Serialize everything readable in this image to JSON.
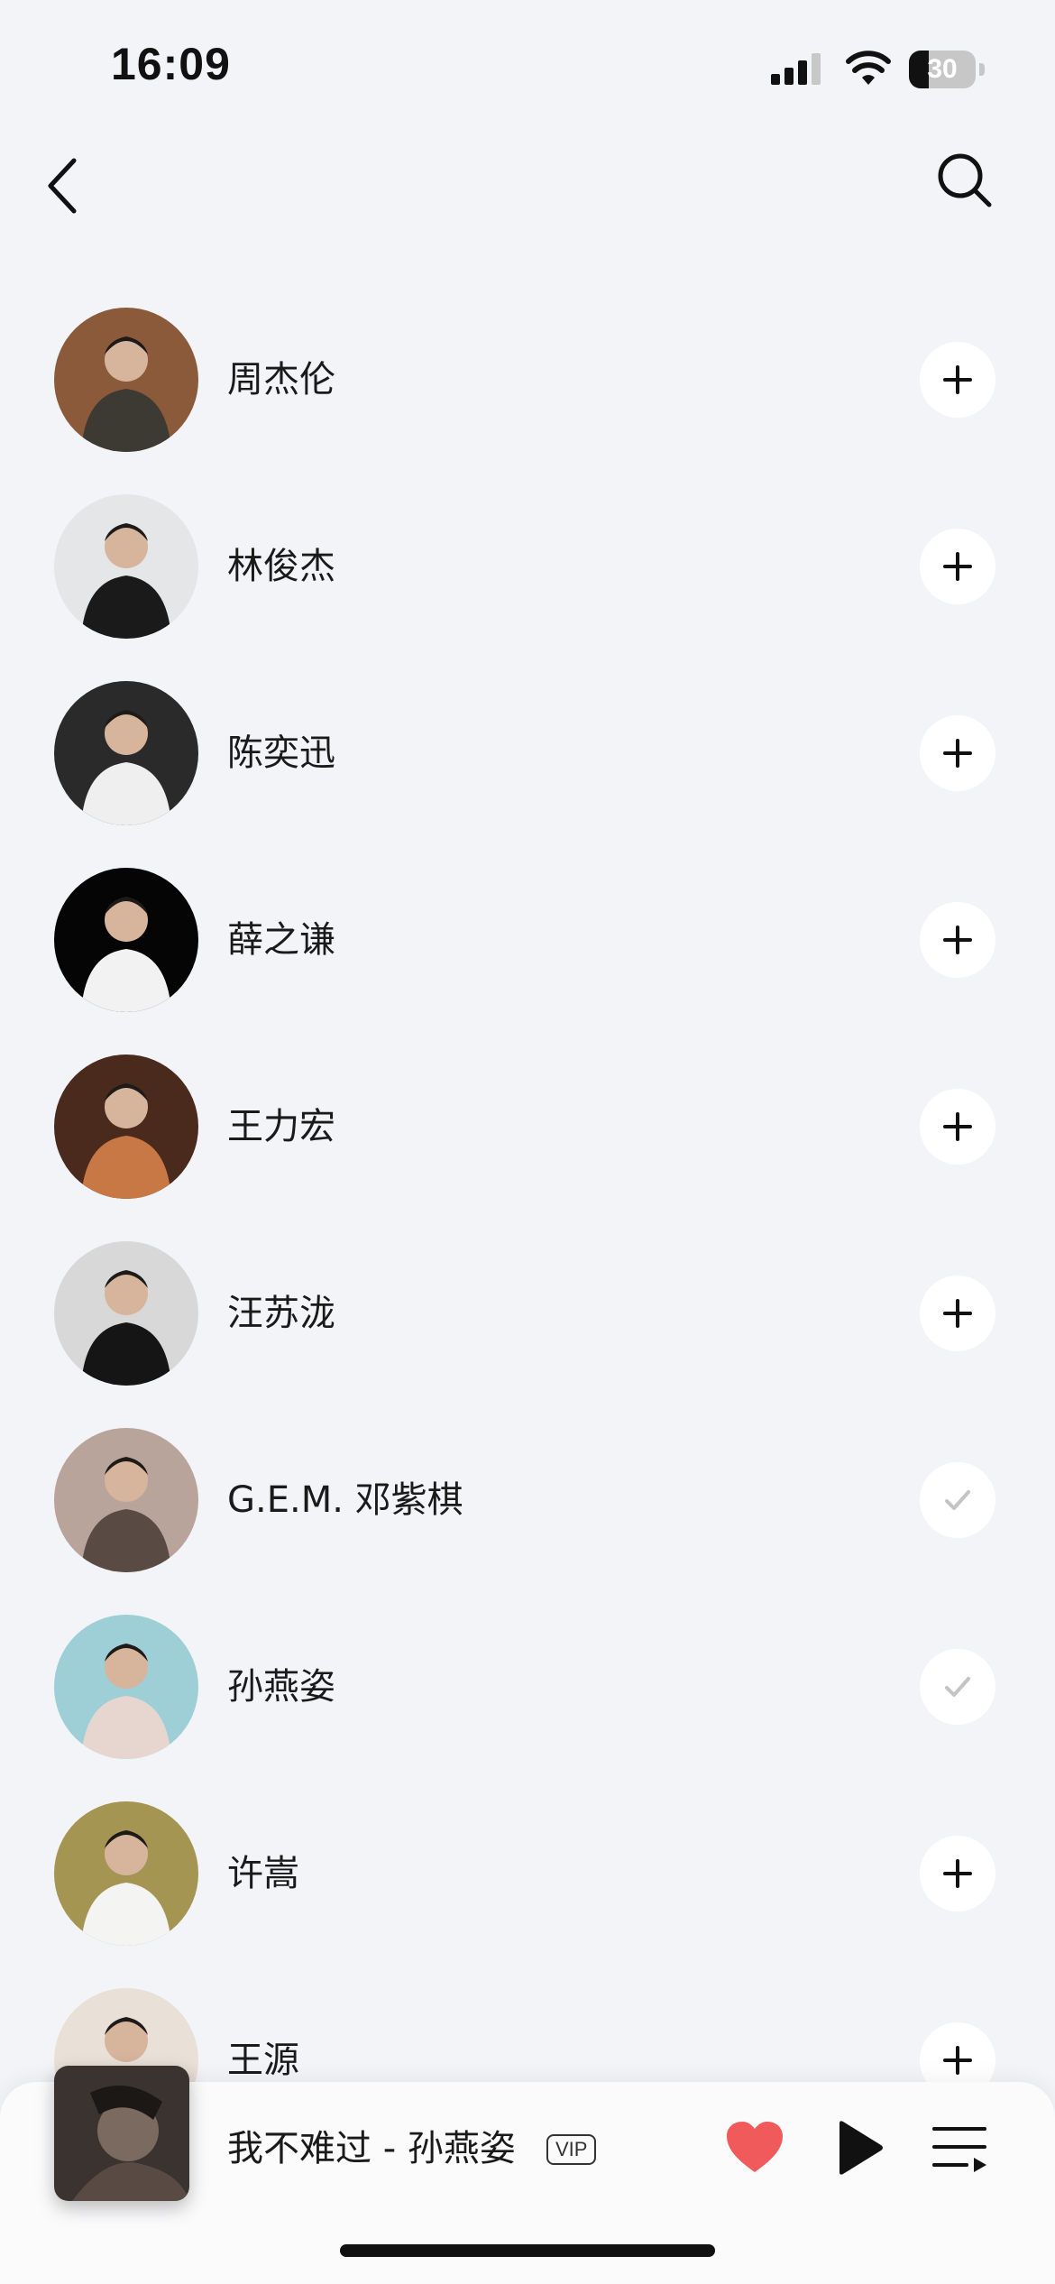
{
  "status_bar": {
    "time": "16:09",
    "battery": "30",
    "battery_level": 0.3
  },
  "nav": {
    "back_icon": "chevron-left-icon",
    "search_icon": "search-icon"
  },
  "artists": [
    {
      "name": "周杰伦",
      "followed": false,
      "avatar_bg": "#8a5a3a",
      "avatar_fg": "#3d3a33"
    },
    {
      "name": "林俊杰",
      "followed": false,
      "avatar_bg": "#e4e6e8",
      "avatar_fg": "#1a1a1a"
    },
    {
      "name": "陈奕迅",
      "followed": false,
      "avatar_bg": "#2a2a2a",
      "avatar_fg": "#efefef"
    },
    {
      "name": "薛之谦",
      "followed": false,
      "avatar_bg": "#050505",
      "avatar_fg": "#f2f2f2"
    },
    {
      "name": "王力宏",
      "followed": false,
      "avatar_bg": "#4a2a1c",
      "avatar_fg": "#c87844"
    },
    {
      "name": "汪苏泷",
      "followed": false,
      "avatar_bg": "#d8d8d8",
      "avatar_fg": "#151515"
    },
    {
      "name": "G.E.M. 邓紫棋",
      "followed": true,
      "avatar_bg": "#b9a49c",
      "avatar_fg": "#5a4a44"
    },
    {
      "name": "孙燕姿",
      "followed": true,
      "avatar_bg": "#9fcfd6",
      "avatar_fg": "#e7d6cf"
    },
    {
      "name": "许嵩",
      "followed": false,
      "avatar_bg": "#a59552",
      "avatar_fg": "#f4f4f2"
    },
    {
      "name": "王源",
      "followed": false,
      "avatar_bg": "#e9e1d8",
      "avatar_fg": "#2a2420"
    }
  ],
  "player": {
    "title": "我不难过 - 孙燕姿",
    "vip": "VIP",
    "liked": true,
    "heart_color": "#f05a5a",
    "album_art_icon": "album-art"
  }
}
